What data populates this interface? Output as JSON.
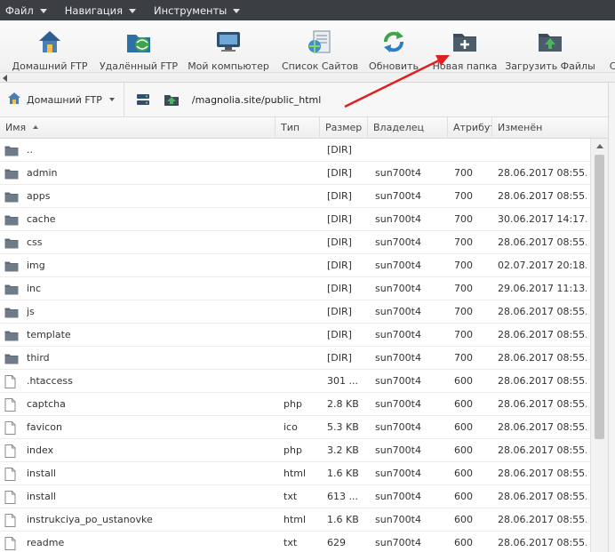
{
  "menu": {
    "items": [
      {
        "label": "Файл"
      },
      {
        "label": "Навигация"
      },
      {
        "label": "Инструменты"
      }
    ]
  },
  "toolbar": {
    "buttons": [
      {
        "label": "Домашний FTP",
        "icon": "home-icon"
      },
      {
        "label": "Удалённый FTP",
        "icon": "remote-ftp-icon"
      },
      {
        "label": "Мой компьютер",
        "icon": "computer-icon"
      },
      {
        "label": "Список Сайтов",
        "icon": "site-list-icon"
      },
      {
        "label": "Обновить",
        "icon": "refresh-icon"
      },
      {
        "label": "Новая папка",
        "icon": "new-folder-icon"
      },
      {
        "label": "Загрузить Файлы",
        "icon": "upload-icon"
      },
      {
        "label": "Со",
        "icon": ""
      }
    ]
  },
  "pathbar": {
    "site": "Домашний FTP",
    "path": "/magnolia.site/public_html"
  },
  "table": {
    "columns": [
      "Имя",
      "Тип",
      "Размер",
      "Владелец",
      "Атрибут",
      "Изменён"
    ],
    "rows": [
      {
        "kind": "folder",
        "name": "..",
        "type": "",
        "size": "[DIR]",
        "owner": "",
        "attr": "",
        "date": ""
      },
      {
        "kind": "folder",
        "name": "admin",
        "type": "",
        "size": "[DIR]",
        "owner": "sun700t4",
        "attr": "700",
        "date": "28.06.2017 08:55..."
      },
      {
        "kind": "folder",
        "name": "apps",
        "type": "",
        "size": "[DIR]",
        "owner": "sun700t4",
        "attr": "700",
        "date": "28.06.2017 08:55..."
      },
      {
        "kind": "folder",
        "name": "cache",
        "type": "",
        "size": "[DIR]",
        "owner": "sun700t4",
        "attr": "700",
        "date": "30.06.2017 14:17..."
      },
      {
        "kind": "folder",
        "name": "css",
        "type": "",
        "size": "[DIR]",
        "owner": "sun700t4",
        "attr": "700",
        "date": "28.06.2017 08:55..."
      },
      {
        "kind": "folder",
        "name": "img",
        "type": "",
        "size": "[DIR]",
        "owner": "sun700t4",
        "attr": "700",
        "date": "02.07.2017 20:18..."
      },
      {
        "kind": "folder",
        "name": "inc",
        "type": "",
        "size": "[DIR]",
        "owner": "sun700t4",
        "attr": "700",
        "date": "29.06.2017 11:13..."
      },
      {
        "kind": "folder",
        "name": "js",
        "type": "",
        "size": "[DIR]",
        "owner": "sun700t4",
        "attr": "700",
        "date": "28.06.2017 08:55..."
      },
      {
        "kind": "folder",
        "name": "template",
        "type": "",
        "size": "[DIR]",
        "owner": "sun700t4",
        "attr": "700",
        "date": "28.06.2017 08:55..."
      },
      {
        "kind": "folder",
        "name": "third",
        "type": "",
        "size": "[DIR]",
        "owner": "sun700t4",
        "attr": "700",
        "date": "28.06.2017 08:55..."
      },
      {
        "kind": "file",
        "name": ".htaccess",
        "type": "",
        "size": "301 ...",
        "owner": "sun700t4",
        "attr": "600",
        "date": "28.06.2017 08:55..."
      },
      {
        "kind": "file",
        "name": "captcha",
        "type": "php",
        "size": "2.8 KB",
        "owner": "sun700t4",
        "attr": "600",
        "date": "28.06.2017 08:55..."
      },
      {
        "kind": "file",
        "name": "favicon",
        "type": "ico",
        "size": "5.3 KB",
        "owner": "sun700t4",
        "attr": "600",
        "date": "28.06.2017 08:55..."
      },
      {
        "kind": "file",
        "name": "index",
        "type": "php",
        "size": "3.2 KB",
        "owner": "sun700t4",
        "attr": "600",
        "date": "28.06.2017 08:55..."
      },
      {
        "kind": "file",
        "name": "install",
        "type": "html",
        "size": "1.6 KB",
        "owner": "sun700t4",
        "attr": "600",
        "date": "28.06.2017 08:55..."
      },
      {
        "kind": "file",
        "name": "install",
        "type": "txt",
        "size": "613 ...",
        "owner": "sun700t4",
        "attr": "600",
        "date": "28.06.2017 08:55..."
      },
      {
        "kind": "file",
        "name": "instrukciya_po_ustanovke",
        "type": "html",
        "size": "1.6 KB",
        "owner": "sun700t4",
        "attr": "600",
        "date": "28.06.2017 08:55..."
      },
      {
        "kind": "file",
        "name": "readme",
        "type": "txt",
        "size": "629",
        "owner": "sun700t4",
        "attr": "600",
        "date": "28.06.2017 08:55..."
      }
    ]
  },
  "colors": {
    "menubar": "#3b3f43",
    "annotation_arrow": "#e02020",
    "folder_icon": "#5f6b76"
  }
}
